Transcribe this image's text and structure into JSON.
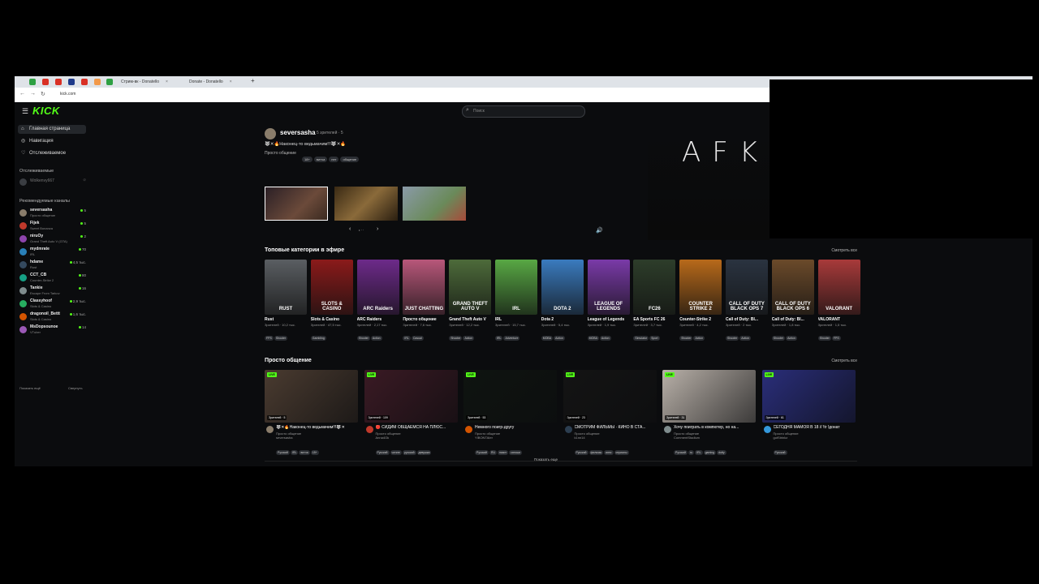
{
  "browser": {
    "tabs": [
      {
        "label": "Стрим-вк - Donatello",
        "color": "#4a7bd6"
      },
      {
        "label": "Donate - Donatello",
        "color": "#4a7bd6"
      }
    ],
    "favicons": [
      "#2ea043",
      "#d93025",
      "#d93025",
      "#1e3a8a",
      "#d93025",
      "#f2994a",
      "#2ea043"
    ],
    "new_tab": "+",
    "url": "kick.com",
    "back": "←",
    "forward": "→",
    "reload": "↻"
  },
  "header": {
    "logo": "KICK",
    "menu_icon": "☰",
    "search_placeholder": "Поиск",
    "search_icon": "🔍"
  },
  "sidebar": {
    "nav": [
      {
        "label": "Главная страница",
        "icon": "⌂",
        "active": true
      },
      {
        "label": "Навигация",
        "icon": "◎",
        "active": false
      },
      {
        "label": "Отслеживаемое",
        "icon": "♡",
        "active": false
      }
    ],
    "following_title": "Отслеживаемые",
    "following": [
      {
        "name": "Wolkenvy667",
        "status": "offline"
      }
    ],
    "recommended_title": "Рекомендуемые каналы",
    "recommended": [
      {
        "name": "seversasha",
        "game": "Просто общение",
        "viewers": "5",
        "color": "#8a7d6b"
      },
      {
        "name": "Fijek",
        "game": "Sweet Bonanza",
        "viewers": "5",
        "color": "#c0392b"
      },
      {
        "name": "niruOy",
        "game": "Grand Theft Auto V (GTA)",
        "viewers": "2",
        "color": "#8e44ad"
      },
      {
        "name": "mydmrate",
        "game": "IRL",
        "viewers": "70",
        "color": "#2980b9"
      },
      {
        "name": "hdame",
        "game": "Rust",
        "viewers": "4,5 тыс.",
        "color": "#34495e"
      },
      {
        "name": "CCT_CB",
        "game": "Counter-Strike 2",
        "viewers": "80",
        "color": "#16a085"
      },
      {
        "name": "Tankie",
        "game": "Escape From Tarkov",
        "viewers": "16",
        "color": "#7f8c8d"
      },
      {
        "name": "Classyhoof",
        "game": "Slots & Casino",
        "viewers": "2,9 тыс.",
        "color": "#27ae60"
      },
      {
        "name": "dragonoil_Bettt",
        "game": "Slots & Casino",
        "viewers": "1,6 тыс.",
        "color": "#d35400"
      },
      {
        "name": "MsDopsounoe",
        "game": "VTuber",
        "viewers": "14",
        "color": "#9b59b6"
      }
    ],
    "footer_left": "Показать ещё",
    "footer_right": "Свернуть"
  },
  "featured": {
    "name": "seversasha",
    "viewers": "5 зрителей · 5",
    "title": "🐺✕🔥Наконец-то ведьмачим!!!🐺✕🔥",
    "category": "Просто общение",
    "tags": [
      "18+",
      "витча",
      "нет",
      "общение"
    ],
    "afk_text": "AFK",
    "volume_icon": "🔊",
    "prev": "‹",
    "next": "›",
    "dots": "• · ·"
  },
  "top_categories": {
    "title": "Топовые категории в эфире",
    "see_all": "Смотреть все",
    "items": [
      {
        "name": "Rust",
        "viewers": "Зрителей · 10,2 тыс.",
        "tags": [
          "FPS",
          "Shooter"
        ],
        "art": "RUST",
        "bg": "#5a5e62"
      },
      {
        "name": "Slots & Casino",
        "viewers": "Зрителей · 47,5 тыс.",
        "tags": [
          "Gambling"
        ],
        "art": "SLOTS & CASINO",
        "bg": "#8b1a1a"
      },
      {
        "name": "ARC Raiders",
        "viewers": "Зрителей · 2,17 тыс.",
        "tags": [
          "Shooter",
          "Action"
        ],
        "art": "ARC Raiders",
        "bg": "#6d2a8a"
      },
      {
        "name": "Просто общение",
        "viewers": "Зрителей · 7,6 тыс.",
        "tags": [
          "IRL",
          "Casual"
        ],
        "art": "JUST CHATTING",
        "bg": "#b8577a"
      },
      {
        "name": "Grand Theft Auto V",
        "viewers": "Зрителей · 12,2 тыс.",
        "tags": [
          "Shooter",
          "Action"
        ],
        "art": "GRAND THEFT AUTO V",
        "bg": "#4d6b3a"
      },
      {
        "name": "IRL",
        "viewers": "Зрителей · 15,7 тыс.",
        "tags": [
          "IRL",
          "Adventure"
        ],
        "art": "IRL",
        "bg": "#58a844"
      },
      {
        "name": "Dota 2",
        "viewers": "Зрителей · 5,4 тыс.",
        "tags": [
          "MOBA",
          "Action"
        ],
        "art": "DOTA 2",
        "bg": "#3a7bbf"
      },
      {
        "name": "League of Legends",
        "viewers": "Зрителей · 1,9 тыс.",
        "tags": [
          "MOBA",
          "Action"
        ],
        "art": "LEAGUE OF LEGENDS",
        "bg": "#7a3aa8"
      },
      {
        "name": "EA Sports FC 26",
        "viewers": "Зрителей · 3,7 тыс.",
        "tags": [
          "Simulator",
          "Sport"
        ],
        "art": "FC26",
        "bg": "#2d3d2a"
      },
      {
        "name": "Counter-Strike 2",
        "viewers": "Зрителей · 4,2 тыс.",
        "tags": [
          "Shooter",
          "Action"
        ],
        "art": "COUNTER STRIKE 2",
        "bg": "#b86a1a"
      },
      {
        "name": "Call of Duty: Bl...",
        "viewers": "Зрителей · 2 тыс.",
        "tags": [
          "Shooter",
          "Action"
        ],
        "art": "CALL OF DUTY BLACK OPS 7",
        "bg": "#2a3340"
      },
      {
        "name": "Call of Duty: Bl...",
        "viewers": "Зрителей · 1,8 тыс.",
        "tags": [
          "Shooter",
          "Action"
        ],
        "art": "CALL OF DUTY BLACK OPS 6",
        "bg": "#6b4a2a"
      },
      {
        "name": "VALORANT",
        "viewers": "Зрителей · 1,5 тыс.",
        "tags": [
          "Shooter",
          "FPS"
        ],
        "art": "VALORANT",
        "bg": "#a83a3a"
      }
    ]
  },
  "just_chatting": {
    "title": "Просто общение",
    "see_all": "Смотреть все",
    "streams": [
      {
        "live": "LIVE",
        "viewers": "Зрителей · 5",
        "title": "🐺✕🔥Наконец-то ведьмачим!!!🐺✕",
        "category": "Просто общение",
        "name": "seversasha",
        "tags": [
          "Русский",
          "IRL",
          "витча",
          "18+"
        ],
        "bg": "#4a3b30",
        "av": "#8a7d6b"
      },
      {
        "live": "LIVE",
        "viewers": "Зрителей · 109",
        "title": "🔴 СИДИМ ОБЩАЕМСЯ НА ПЛЮС...",
        "category": "Просто общение",
        "name": "Anna4Ok",
        "tags": [
          "Русский",
          "чатинг",
          "русский",
          "девушка"
        ],
        "bg": "#3a1a24",
        "av": "#c0392b"
      },
      {
        "live": "LIVE",
        "viewers": "Зрителей · 53",
        "title": "Немного поигр-другу",
        "category": "Просто общение",
        "name": "YIBONTAIer",
        "tags": [
          "Русский",
          "RU",
          "никит",
          "сатоши"
        ],
        "bg": "#0f1410",
        "av": "#d35400"
      },
      {
        "live": "LIVE",
        "viewers": "Зрителей · 23",
        "title": "СМОТРИМ ФИЛЬМЫ · КИНО В СТА...",
        "category": "Просто общение",
        "name": "k1nn14",
        "tags": [
          "Русский",
          "фильмы",
          "кино",
          "сериалы"
        ],
        "bg": "#141414",
        "av": "#2c3e50"
      },
      {
        "live": "LIVE",
        "viewers": "Зрителей · 31",
        "title": "Хочу поиграть в компютер, но на...",
        "category": "Просто общение",
        "name": "CommentStadium",
        "tags": [
          "Русский",
          "ru",
          "IRL",
          "gaming",
          "dotty"
        ],
        "bg": "#b8b0a8",
        "av": "#7f8c8d"
      },
      {
        "live": "LIVE",
        "viewers": "Зрителей · 61",
        "title": "СЕГОДНЯ МАМОЯ В 18 // !tr !донат",
        "category": "Просто общение",
        "name": "gotStrinkz",
        "tags": [
          "Русский"
        ],
        "bg": "#2a2e7a",
        "av": "#3498db"
      }
    ],
    "show_more": "Показать еще"
  }
}
